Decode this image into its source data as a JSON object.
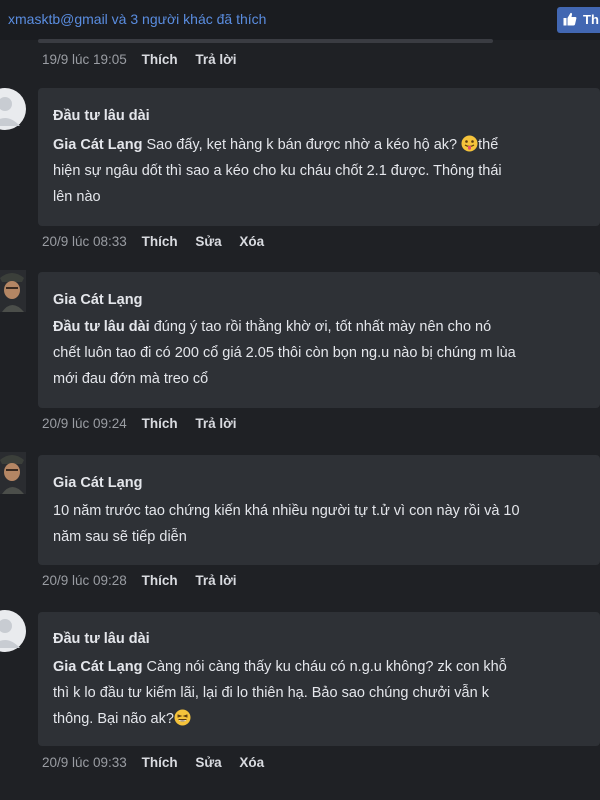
{
  "header": {
    "likes_text": "xmasktb@gmail và 3 người khác đã thích",
    "like_button_label": "Th"
  },
  "comments": [
    {
      "time": "19/9 lúc 19:05",
      "actions": [
        "Thích",
        "Trả lời"
      ]
    },
    {
      "author": "Đầu tư lâu dài",
      "mention": "Gia Cát Lạng",
      "lines": [
        " Sao đấy, kẹt hàng k bán được nhờ a kéo hộ ak? ",
        "thể",
        "hiện sự ngâu dốt thì sao a kéo cho ku cháu chốt 2.1 được. Thông thái",
        "lên nào"
      ],
      "time": "20/9 lúc 08:33",
      "actions": [
        "Thích",
        "Sửa",
        "Xóa"
      ]
    },
    {
      "author": "Gia Cát Lạng",
      "mention": "Đầu tư lâu dài",
      "lines": [
        " đúng ý tao rồi thằng khờ ơi, tốt nhất mày nên cho nó",
        "chết luôn tao đi có 200 cổ giá 2.05 thôi còn bọn ng.u nào bị chúng m lùa",
        "mới đau đớn mà treo cổ"
      ],
      "time": "20/9 lúc 09:24",
      "actions": [
        "Thích",
        "Trả lời"
      ]
    },
    {
      "author": "Gia Cát Lạng",
      "lines": [
        "10 năm trước tao chứng kiến khá nhiều người tự t.ử vì con này rồi và 10",
        "năm sau sẽ tiếp diễn"
      ],
      "time": "20/9 lúc 09:28",
      "actions": [
        "Thích",
        "Trả lời"
      ]
    },
    {
      "author": "Đầu tư lâu dài",
      "mention": "Gia Cát Lạng",
      "lines": [
        " Càng nói càng thấy ku cháu có n.g.u không? zk con khỗ",
        "thì k lo đầu tư kiếm lãi, lại đi lo thiên hạ. Bảo sao chúng chưởi vẫn k",
        "thông. Bại não ak?"
      ],
      "time": "20/9 lúc 09:33",
      "actions": [
        "Thích",
        "Sửa",
        "Xóa"
      ]
    }
  ],
  "icons": {
    "like_button_icon": "thumbs-up-icon",
    "emoji_1": "tongue-out-emoji-icon",
    "emoji_2": "laughing-emoji-icon",
    "avatar_default": "default-avatar-icon",
    "avatar_photo": "soldier-avatar-icon"
  },
  "colors": {
    "background": "#1f2125",
    "bubble": "#2e3136",
    "link": "#5a8de0",
    "like_button": "#4267b2"
  }
}
